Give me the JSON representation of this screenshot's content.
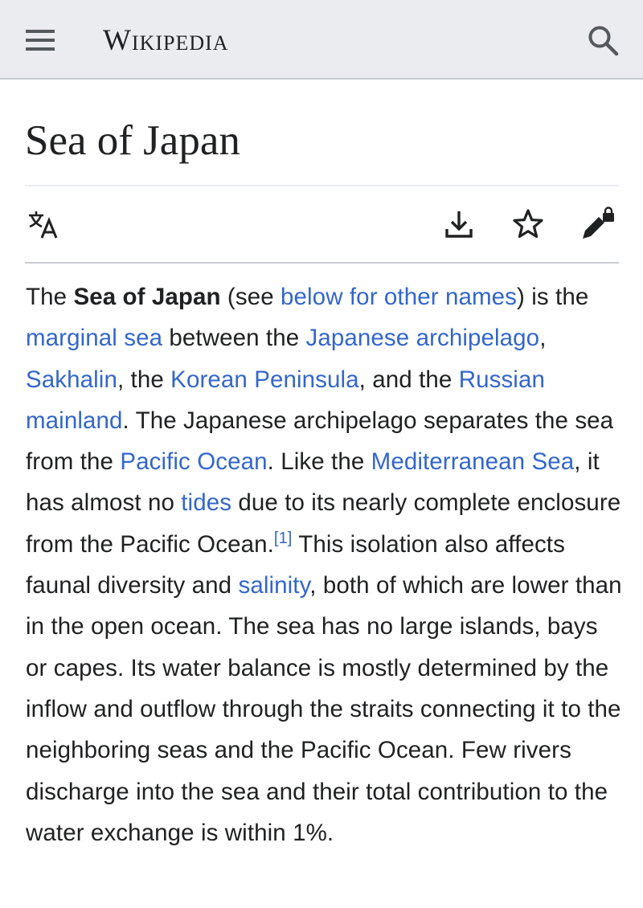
{
  "header": {
    "wordmark": "Wikipedia",
    "menu_icon": "hamburger-menu-icon",
    "search_icon": "search-icon",
    "background": "#eaecf0"
  },
  "page": {
    "title": "Sea of Japan"
  },
  "actions": {
    "language_icon": "language-icon",
    "download_icon": "download-icon",
    "watch_icon": "star-icon",
    "edit_icon": "edit-locked-icon"
  },
  "article": {
    "link_color": "#3366cc",
    "text_color": "#202122",
    "p1": {
      "t1": "The ",
      "bold": "Sea of Japan",
      "t2": " (see ",
      "l1": "below for other names",
      "t3": ") is the ",
      "l2": "marginal sea",
      "t4": " between the ",
      "l3": "Japanese archipelago",
      "t5": ", ",
      "l4": "Sakhalin",
      "t6": ", the ",
      "l5": "Korean Peninsula",
      "t7": ", and the ",
      "l6": "Russian mainland",
      "t8": ". The Japanese archipelago separates the sea from the ",
      "l7": "Pacific Ocean",
      "t9": ". Like the ",
      "l8": "Mediterranean Sea",
      "t10": ", it has almost no ",
      "l9": "tides",
      "t11": " due to its nearly complete enclosure from the Pacific Ocean.",
      "ref1": "[1]",
      "t12": " This isolation also affects faunal diversity and ",
      "l10": "salinity",
      "t13": ", both of which are lower than in the open ocean. The sea has no large islands, bays or capes. Its water balance is mostly determined by the inflow and outflow through the straits connecting it to the neighboring seas and the Pacific Ocean. Few rivers discharge into the sea and their total contribution to the water exchange is within 1%."
    }
  }
}
